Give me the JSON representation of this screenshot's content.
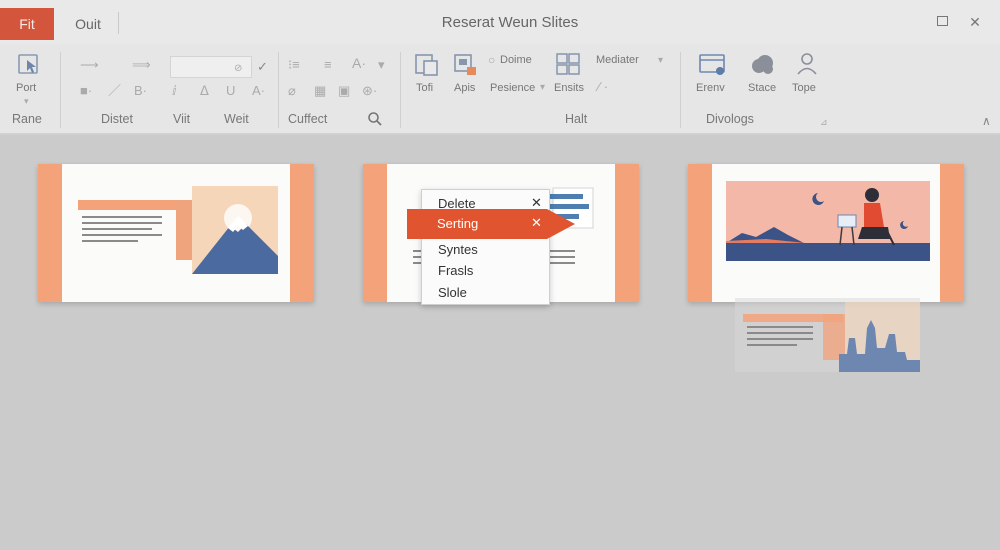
{
  "titlebar": {
    "tabs": [
      {
        "label": "Fit",
        "active": true
      },
      {
        "label": "Ouit",
        "active": false
      }
    ],
    "title": "Reserat Weun Slites",
    "accent": "#d2553c"
  },
  "ribbon": {
    "buttons": [
      {
        "id": "port",
        "label": "Port",
        "icon": "pointer-icon"
      },
      {
        "id": "tofi",
        "label": "Tofi",
        "icon": "layout-icon"
      },
      {
        "id": "apis",
        "label": "Apis",
        "icon": "image-icon"
      },
      {
        "id": "dome",
        "label": "Doime",
        "icon": "circle-icon"
      },
      {
        "id": "presence",
        "label": "Pesience",
        "icon": "text-icon"
      },
      {
        "id": "ensits",
        "label": "Ensits",
        "icon": "grid-icon"
      },
      {
        "id": "mediater",
        "label": "Mediater",
        "icon": "chevron-down-icon"
      },
      {
        "id": "erenv",
        "label": "Erenv",
        "icon": "browser-icon"
      },
      {
        "id": "stace",
        "label": "Stace",
        "icon": "cloud-icon"
      },
      {
        "id": "tope",
        "label": "Tope",
        "icon": "person-icon"
      }
    ],
    "groups": [
      "Rane",
      "Distet",
      "Viit",
      "Weit",
      "Cuffect",
      "Halt",
      "Divologs"
    ]
  },
  "context_menu": {
    "items": [
      "Delete",
      "Serting",
      "Syntes",
      "Frasls",
      "Slole"
    ],
    "highlighted_index": 1,
    "highlight_color": "#e0542f"
  },
  "colors": {
    "slide_band": "#f4a27a",
    "mountain_sky": "#f6d6b8",
    "mountain": "#4a6aa0",
    "scene_sky": "#f3b8a8",
    "ground": "#3b5386"
  }
}
